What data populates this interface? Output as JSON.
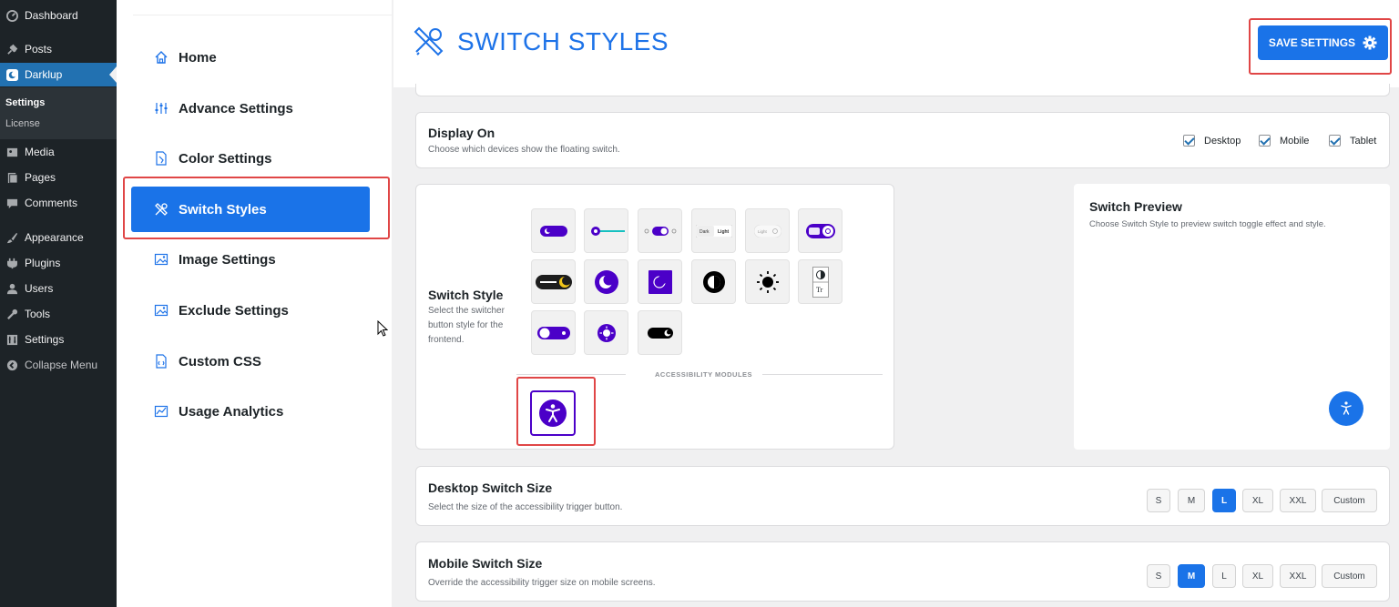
{
  "wp_menu": {
    "items": [
      {
        "label": "Dashboard",
        "icon": "dashboard-icon"
      },
      {
        "label": "Posts",
        "icon": "pin-icon"
      },
      {
        "label": "Darklup",
        "icon": "darklup-icon"
      },
      {
        "label": "Media",
        "icon": "media-icon"
      },
      {
        "label": "Pages",
        "icon": "pages-icon"
      },
      {
        "label": "Comments",
        "icon": "comments-icon"
      },
      {
        "label": "Appearance",
        "icon": "brush-icon"
      },
      {
        "label": "Plugins",
        "icon": "plugin-icon"
      },
      {
        "label": "Users",
        "icon": "user-icon"
      },
      {
        "label": "Tools",
        "icon": "wrench-icon"
      },
      {
        "label": "Settings",
        "icon": "settings-icon"
      },
      {
        "label": "Collapse Menu",
        "icon": "collapse-icon"
      }
    ],
    "submenu": [
      "Settings",
      "License"
    ]
  },
  "plugin_nav": {
    "items": [
      {
        "label": "Home",
        "icon": "home-icon"
      },
      {
        "label": "Advance Settings",
        "icon": "sliders-icon"
      },
      {
        "label": "Color Settings",
        "icon": "palette-icon"
      },
      {
        "label": "Switch Styles",
        "icon": "tools-icon"
      },
      {
        "label": "Image Settings",
        "icon": "image-icon"
      },
      {
        "label": "Exclude Settings",
        "icon": "image-icon"
      },
      {
        "label": "Custom CSS",
        "icon": "css-icon"
      },
      {
        "label": "Usage Analytics",
        "icon": "analytics-icon"
      }
    ],
    "active": "Switch Styles"
  },
  "header": {
    "title": "SWITCH STYLES",
    "save_label": "SAVE SETTINGS"
  },
  "display_on": {
    "title": "Display On",
    "desc": "Choose which devices show the floating switch.",
    "options": [
      {
        "label": "Desktop",
        "checked": true
      },
      {
        "label": "Mobile",
        "checked": true
      },
      {
        "label": "Tablet",
        "checked": true
      }
    ]
  },
  "switch_style": {
    "title": "Switch Style",
    "desc_lines": [
      "Select the switcher",
      "button style for the",
      "frontend."
    ],
    "tile_texts": {
      "dark": "Dark",
      "light": "Light",
      "light_small": "Light",
      "tr": "Tr"
    },
    "accessibility_label": "ACCESSIBILITY MODULES"
  },
  "switch_preview": {
    "title": "Switch Preview",
    "desc": "Choose Switch Style to preview switch toggle effect and style."
  },
  "desktop_size": {
    "title": "Desktop Switch Size",
    "desc": "Select the size of the accessibility trigger button.",
    "options": [
      "S",
      "M",
      "L",
      "XL",
      "XXL",
      "Custom"
    ],
    "selected": "L"
  },
  "mobile_size": {
    "title": "Mobile Switch Size",
    "desc": "Override the accessibility trigger size on mobile screens.",
    "options": [
      "S",
      "M",
      "L",
      "XL",
      "XXL",
      "Custom"
    ],
    "selected": "M"
  },
  "colors": {
    "accent": "#1a73e8",
    "switch_purple": "#4b00c8",
    "wp_dark": "#1d2327",
    "wp_active": "#2271b1",
    "highlight_red": "#e04646"
  }
}
